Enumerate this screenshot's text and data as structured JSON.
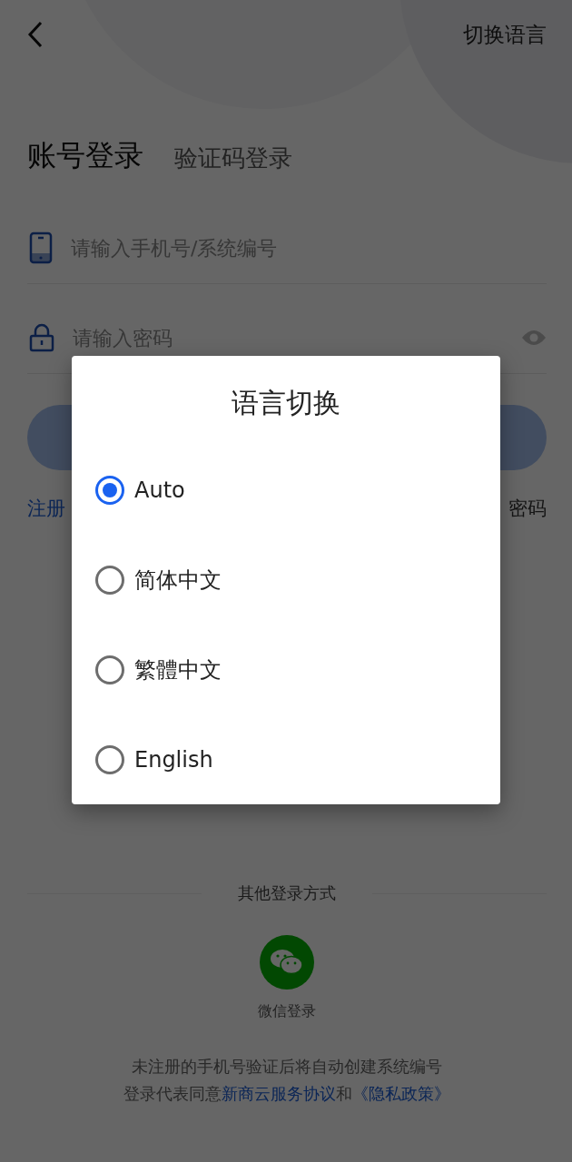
{
  "top_bar": {
    "language_link": "切换语言"
  },
  "tabs": [
    {
      "label": "账号登录",
      "selected": true
    },
    {
      "label": "验证码登录",
      "selected": false
    }
  ],
  "phone_field": {
    "placeholder": "请输入手机号/系统编号"
  },
  "password_field": {
    "placeholder": "请输入密码"
  },
  "links": {
    "register": "注册",
    "forgot": "密码"
  },
  "other_login": {
    "title": "其他登录方式",
    "options": [
      {
        "label": "微信登录"
      }
    ]
  },
  "legal": {
    "line_1": "未注册的手机号验证后将自动创建系统编号",
    "line_2": [
      {
        "kind": "text",
        "text": "登录代表同意"
      },
      {
        "kind": "link",
        "text": "新商云服务协议"
      },
      {
        "kind": "text",
        "text": "和"
      },
      {
        "kind": "link",
        "text": "《隐私政策》"
      }
    ]
  },
  "dialog": {
    "title": "语言切换",
    "options": [
      {
        "label": "Auto",
        "selected": true
      },
      {
        "label": "简体中文",
        "selected": false
      },
      {
        "label": "繁體中文",
        "selected": false
      },
      {
        "label": "English",
        "selected": false
      }
    ]
  }
}
